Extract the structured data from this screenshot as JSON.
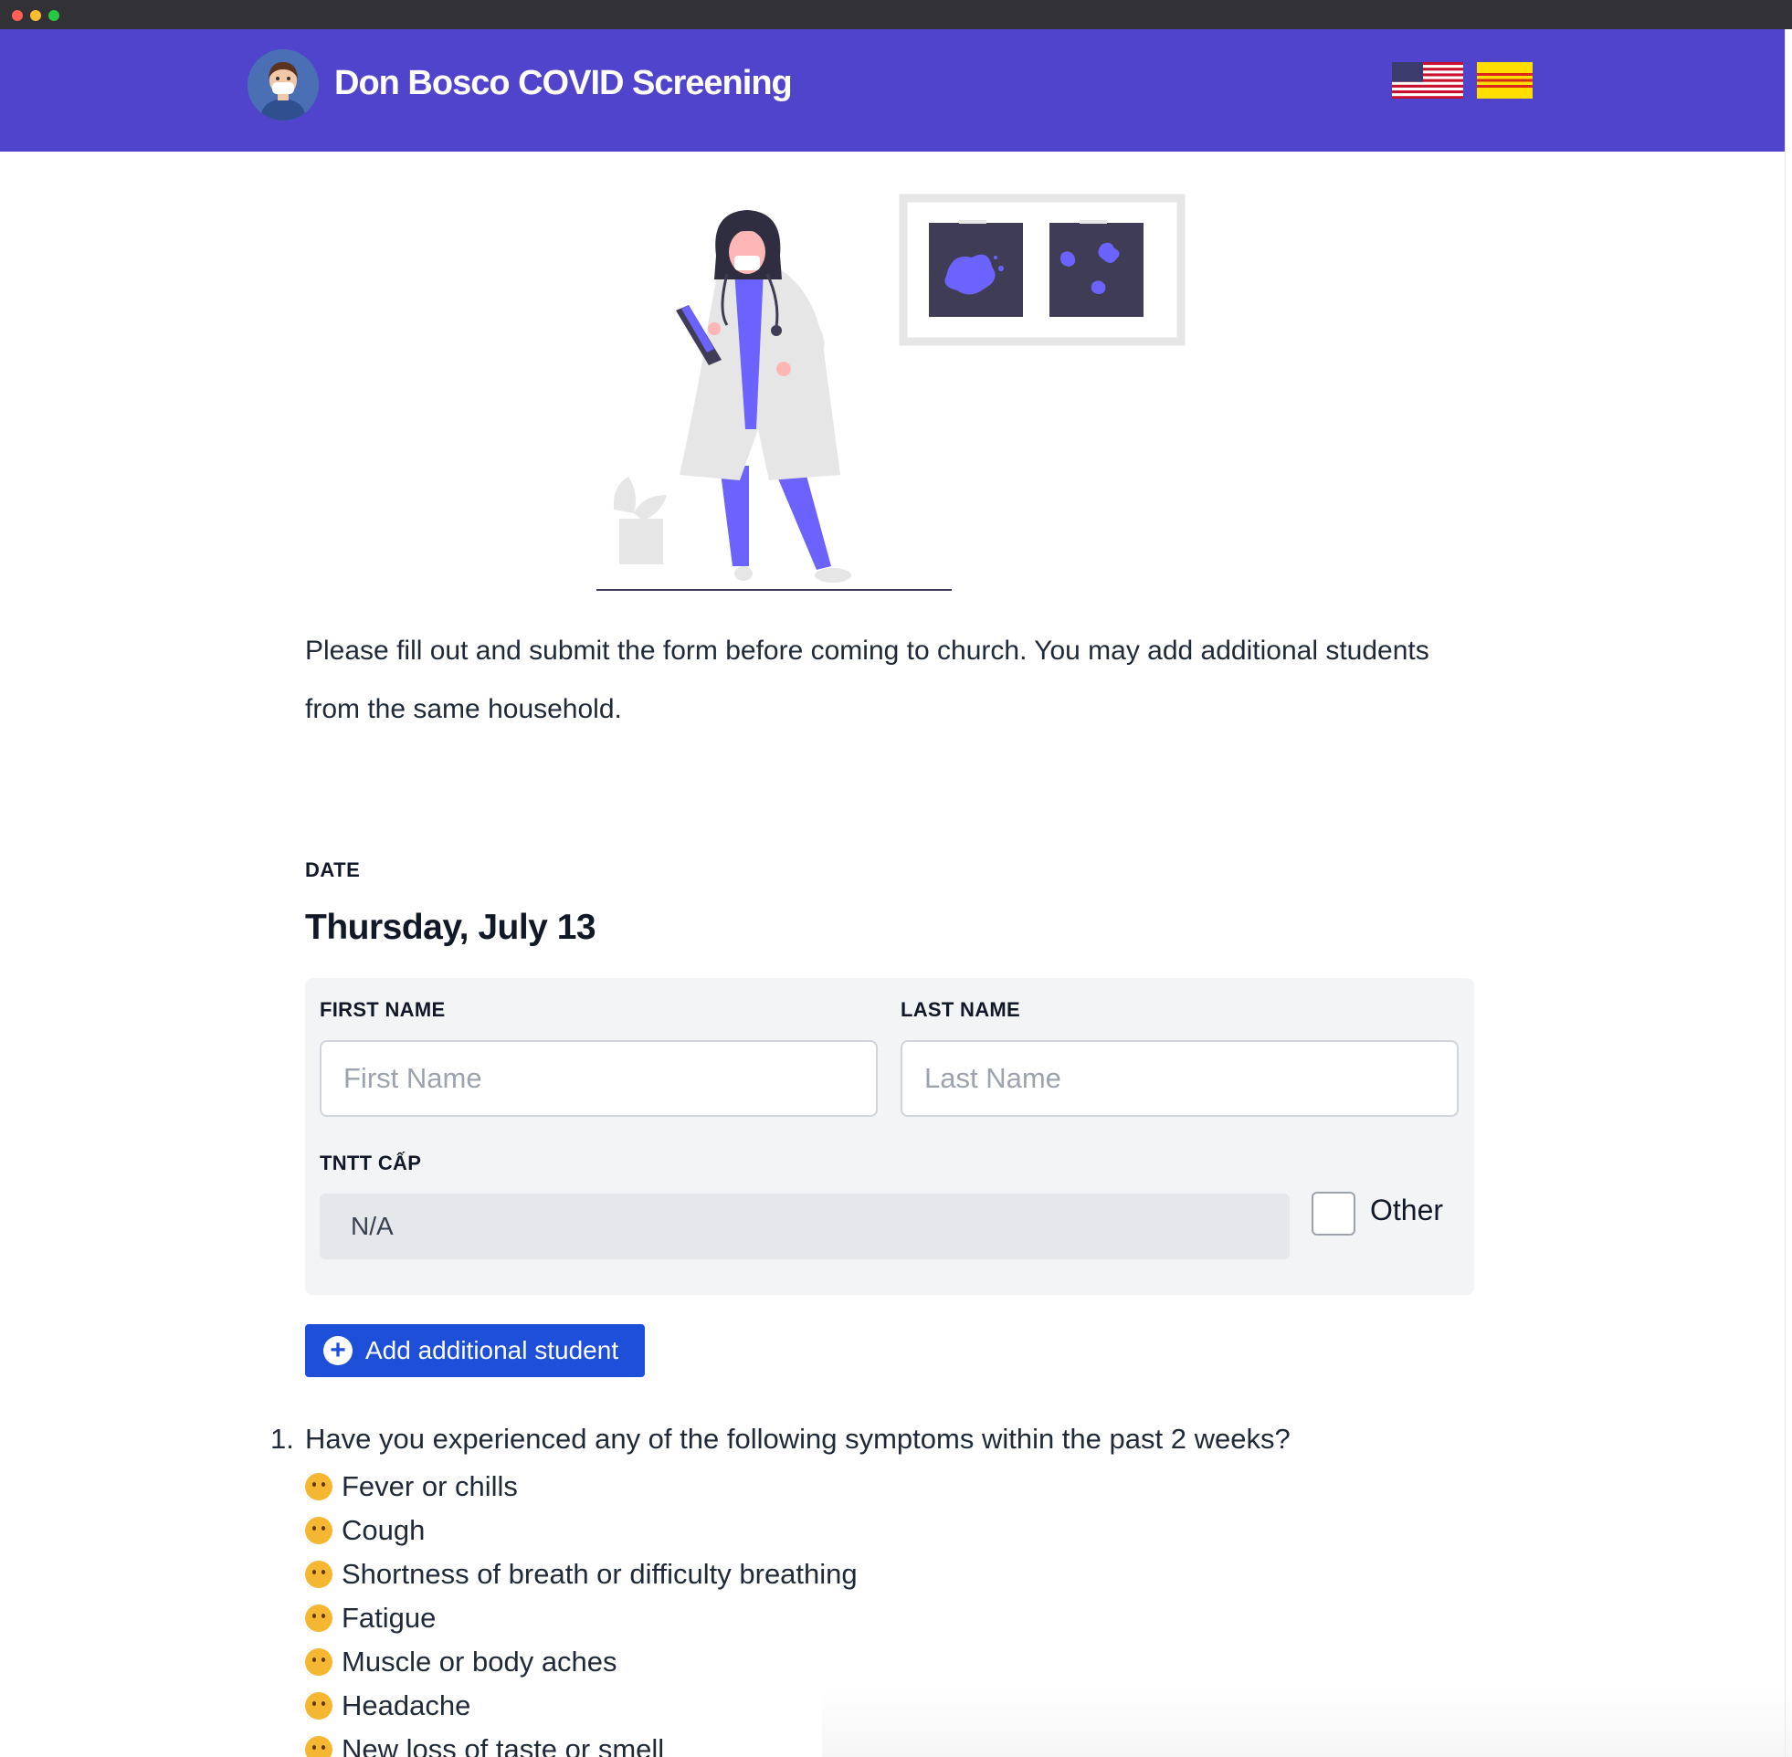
{
  "header": {
    "title": "Don Bosco COVID Screening",
    "languages": [
      {
        "name": "English",
        "icon": "us-flag-icon"
      },
      {
        "name": "Vietnamese",
        "icon": "vietnam-heritage-flag-icon"
      }
    ]
  },
  "intro": {
    "text": "Please fill out and submit the form before coming to church. You may add additional students from the same household."
  },
  "date": {
    "label": "DATE",
    "value": "Thursday, July 13"
  },
  "student": {
    "first_name_label": "FIRST NAME",
    "first_name_placeholder": "First Name",
    "first_name_value": "",
    "last_name_label": "LAST NAME",
    "last_name_placeholder": "Last Name",
    "last_name_value": "",
    "cap_label": "TNTT CẤP",
    "cap_value": "N/A",
    "other_label": "Other",
    "other_checked": false
  },
  "add_button": {
    "label": "Add additional student",
    "icon": "plus-circle-icon"
  },
  "questions": [
    {
      "number": "1.",
      "text": "Have you experienced any of the following symptoms within the past 2 weeks?",
      "symptoms": [
        {
          "icon": "hot-face-emoji-icon",
          "label": "Fever or chills"
        },
        {
          "icon": "coughing-face-emoji-icon",
          "label": "Cough"
        },
        {
          "icon": "tired-face-emoji-icon",
          "label": "Shortness of breath or difficulty breathing"
        },
        {
          "icon": "sleepy-face-emoji-icon",
          "label": "Fatigue"
        },
        {
          "icon": "bandaged-face-emoji-icon",
          "label": "Muscle or body aches"
        },
        {
          "icon": "exploding-head-emoji-icon",
          "label": "Headache"
        },
        {
          "icon": "unamused-face-emoji-icon",
          "label": "New loss of taste or smell"
        }
      ]
    }
  ],
  "colors": {
    "header_bg": "#5044cc",
    "button_bg": "#1d4fd8",
    "card_bg": "#f3f4f6",
    "illustration_accent": "#6c63ff"
  }
}
